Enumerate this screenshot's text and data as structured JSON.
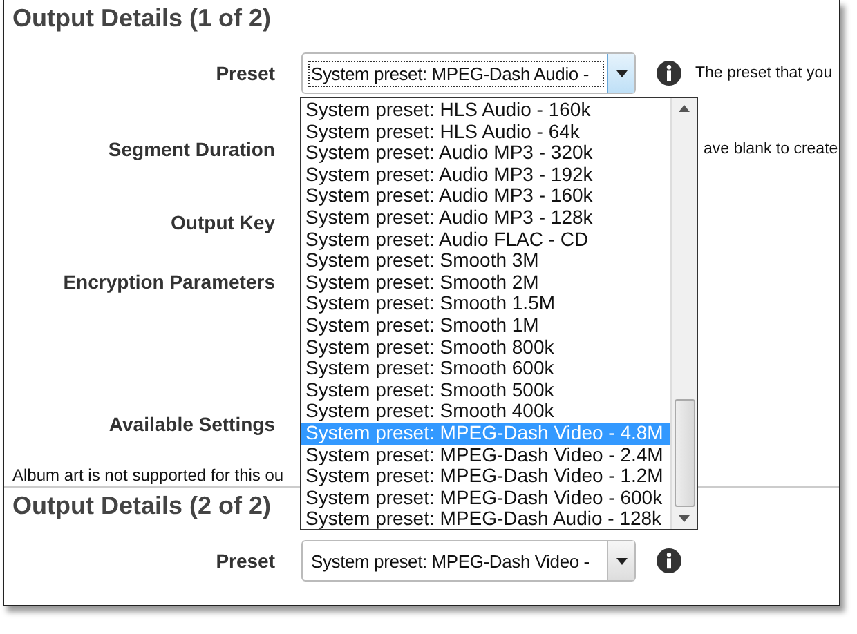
{
  "sections": [
    {
      "title": "Output Details (1 of 2)",
      "fields": [
        {
          "kind": "select",
          "label": "Preset",
          "value": "System preset: MPEG-Dash Audio -",
          "focused": true,
          "help": "The preset that you"
        },
        {
          "kind": "plain",
          "label": "Segment Duration",
          "help": "ave blank to create"
        },
        {
          "kind": "plain",
          "label": "Output Key"
        },
        {
          "kind": "textarea",
          "label": "Encryption Parameters"
        },
        {
          "kind": "plain",
          "label": "Available Settings"
        }
      ],
      "note": "Album art is not supported for this ou"
    },
    {
      "title": "Output Details (2 of 2)",
      "fields": [
        {
          "kind": "select",
          "label": "Preset",
          "value": "System preset: MPEG-Dash Video -",
          "focused": false
        }
      ]
    }
  ],
  "dropdown": {
    "options": [
      {
        "label": "System preset: HLS Audio - 160k",
        "selected": false
      },
      {
        "label": "System preset: HLS Audio - 64k",
        "selected": false
      },
      {
        "label": "System preset: Audio MP3 - 320k",
        "selected": false
      },
      {
        "label": "System preset: Audio MP3 - 192k",
        "selected": false
      },
      {
        "label": "System preset: Audio MP3 - 160k",
        "selected": false
      },
      {
        "label": "System preset: Audio MP3 - 128k",
        "selected": false
      },
      {
        "label": "System preset: Audio FLAC - CD",
        "selected": false
      },
      {
        "label": "System preset: Smooth 3M",
        "selected": false
      },
      {
        "label": "System preset: Smooth 2M",
        "selected": false
      },
      {
        "label": "System preset: Smooth 1.5M",
        "selected": false
      },
      {
        "label": "System preset: Smooth 1M",
        "selected": false
      },
      {
        "label": "System preset: Smooth 800k",
        "selected": false
      },
      {
        "label": "System preset: Smooth 600k",
        "selected": false
      },
      {
        "label": "System preset: Smooth 500k",
        "selected": false
      },
      {
        "label": "System preset: Smooth 400k",
        "selected": false
      },
      {
        "label": "System preset: MPEG-Dash Video - 4.8M",
        "selected": true
      },
      {
        "label": "System preset: MPEG-Dash Video - 2.4M",
        "selected": false
      },
      {
        "label": "System preset: MPEG-Dash Video - 1.2M",
        "selected": false
      },
      {
        "label": "System preset: MPEG-Dash Video - 600k",
        "selected": false
      },
      {
        "label": "System preset: MPEG-Dash Audio - 128k",
        "selected": false
      }
    ]
  }
}
